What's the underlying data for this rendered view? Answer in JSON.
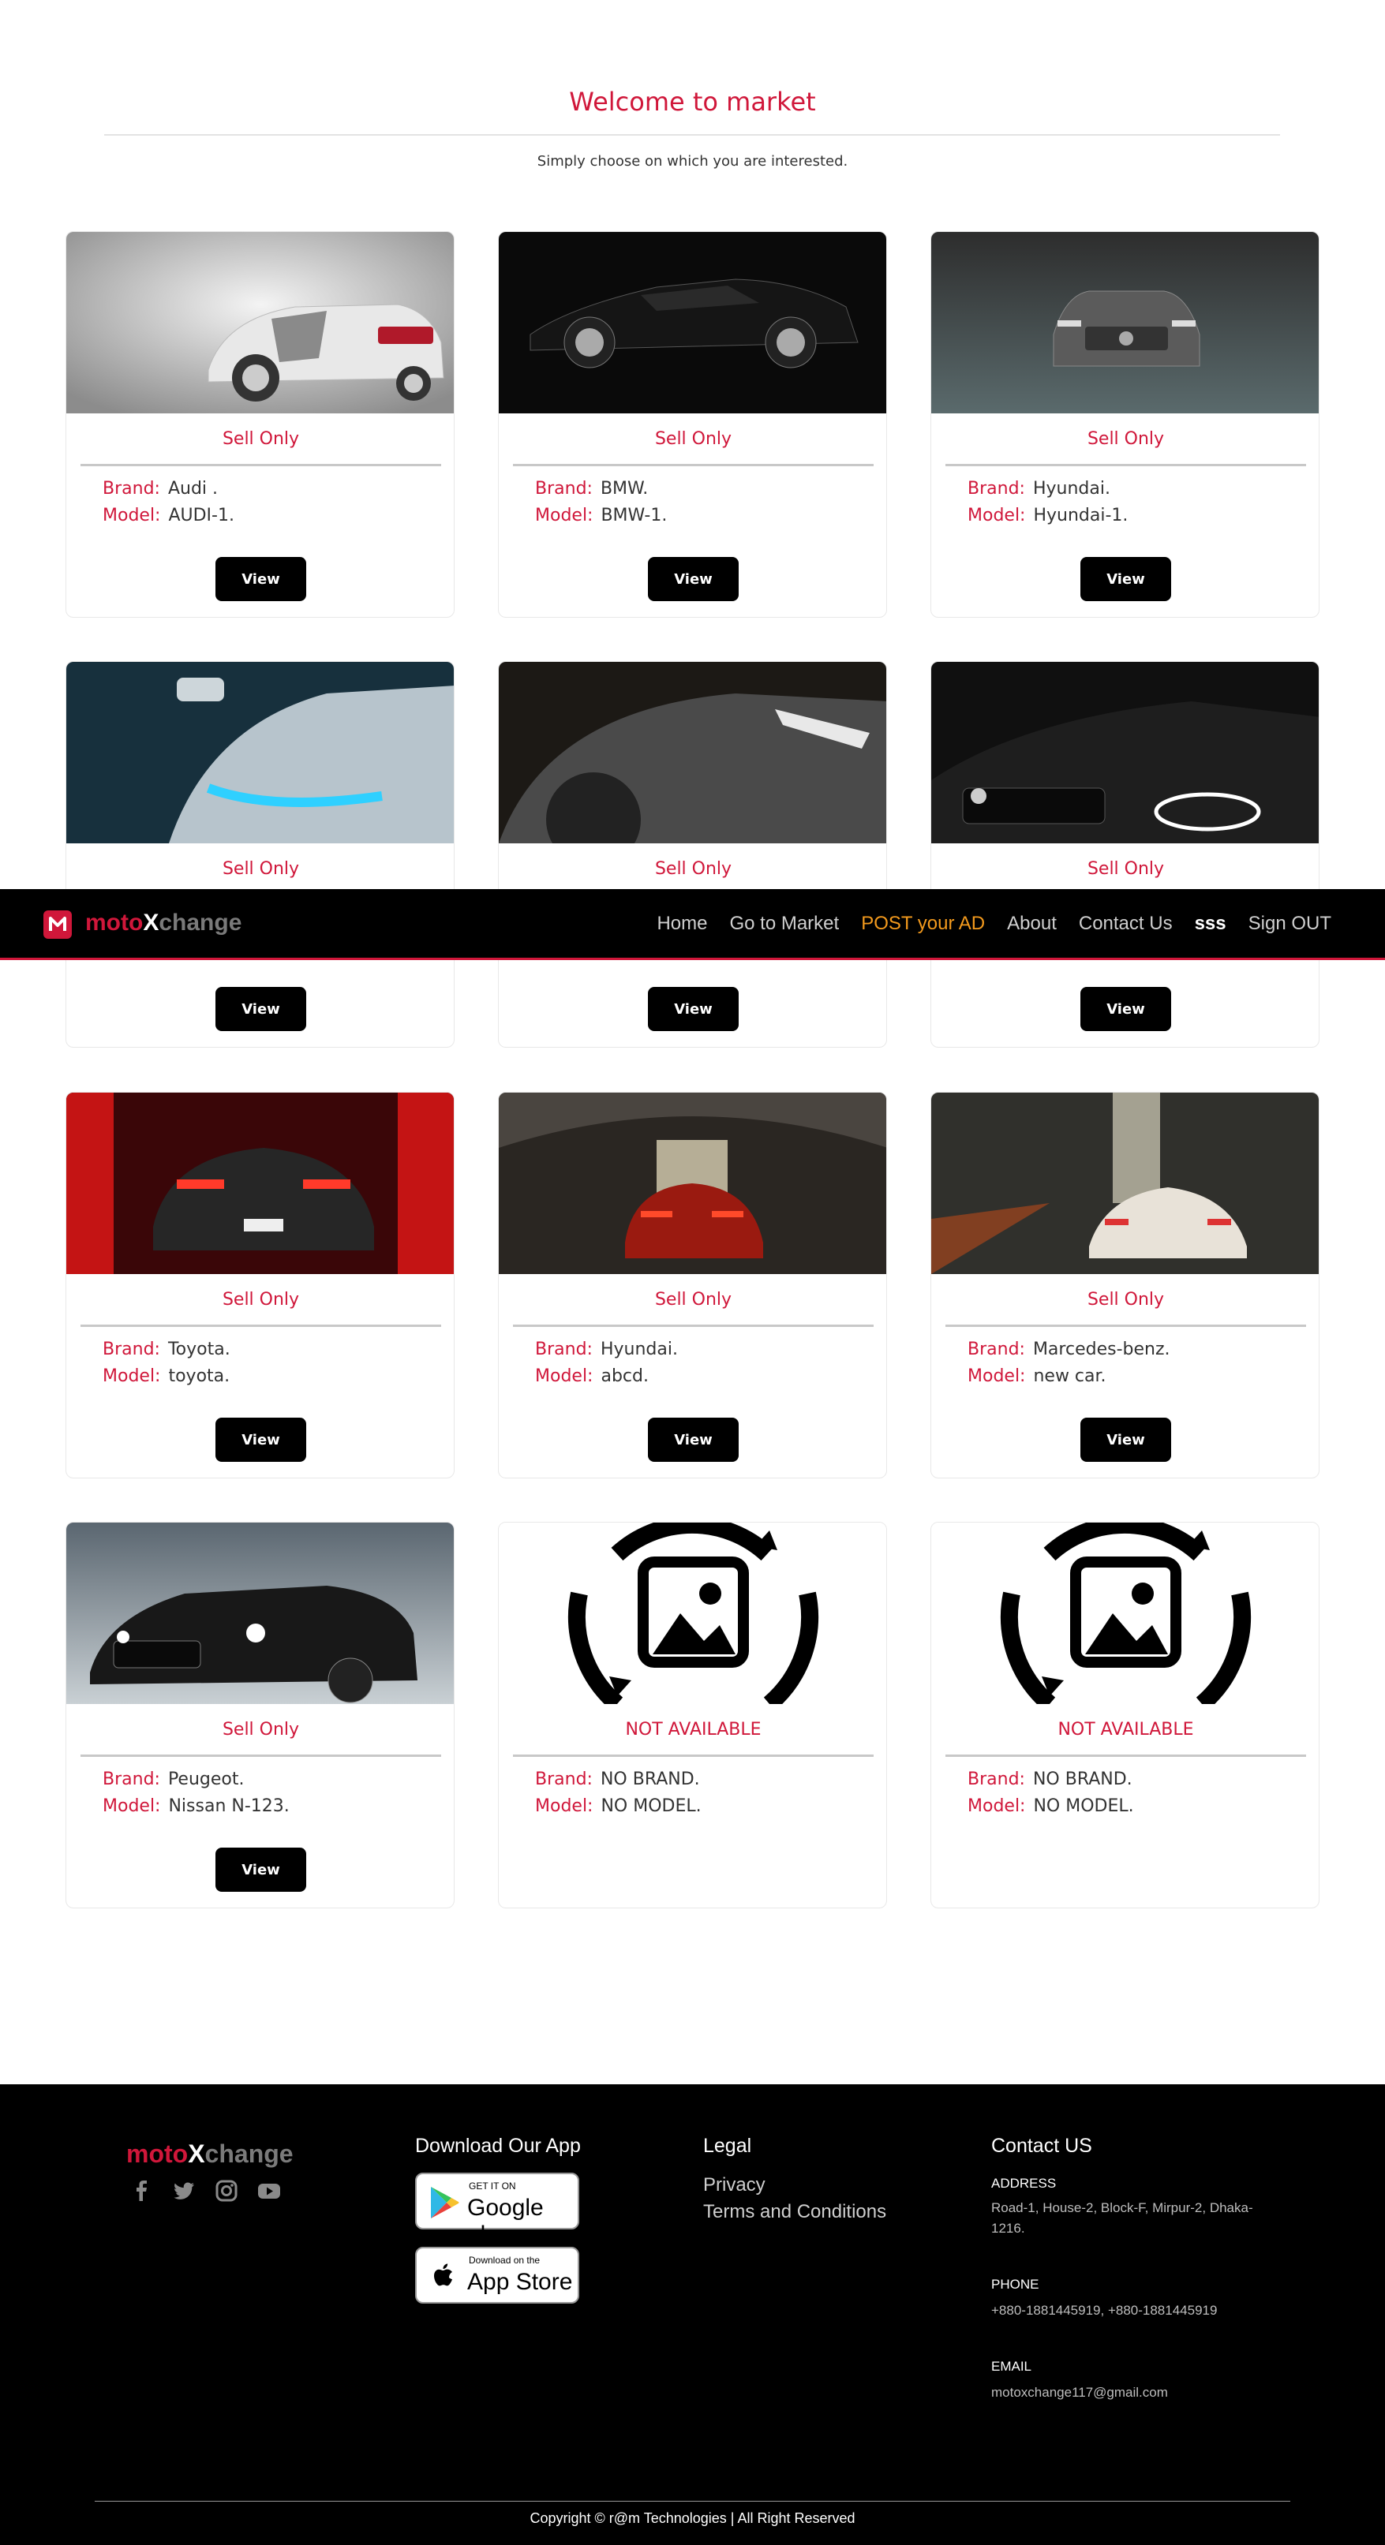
{
  "hero": {
    "title": "Welcome to market",
    "subtitle": "Simply choose on which you are interested."
  },
  "colors": {
    "accent": "#d0173a",
    "nav_active": "#f39a1d",
    "button": "#000000"
  },
  "spec_labels": {
    "brand": "Brand:",
    "model": "Model:"
  },
  "view_label": "View",
  "cards": [
    {
      "status": "Sell Only",
      "brand": "Audi .",
      "model": "AUDI-1.",
      "image": "white-audi-r8"
    },
    {
      "status": "Sell Only",
      "brand": "BMW.",
      "model": "BMW-1.",
      "image": "black-lamborghini-side"
    },
    {
      "status": "Sell Only",
      "brand": "Hyundai.",
      "model": "Hyundai-1.",
      "image": "volvo-suv-front"
    },
    {
      "status": "Sell Only",
      "brand": "",
      "model": "",
      "image": "audi-blue-headlight"
    },
    {
      "status": "Sell Only",
      "brand": "",
      "model": "",
      "image": "grey-lamborghini-headlight"
    },
    {
      "status": "Sell Only",
      "brand": "",
      "model": "",
      "image": "bmw-front-dark"
    },
    {
      "status": "Sell Only",
      "brand": "Toyota.",
      "model": "toyota.",
      "image": "red-ferrari-rear"
    },
    {
      "status": "Sell Only",
      "brand": "Hyundai.",
      "model": "abcd.",
      "image": "ferrari-in-hangar"
    },
    {
      "status": "Sell Only",
      "brand": "Marcedes-benz.",
      "model": "new car.",
      "image": "white-supercar-hangar"
    },
    {
      "status": "Sell Only",
      "brand": "Peugeot.",
      "model": "Nissan N-123.",
      "image": "maserati-black"
    },
    {
      "status": "NOT AVAILABLE",
      "brand": "NO BRAND.",
      "model": "NO MODEL.",
      "image": "image-placeholder-icon"
    },
    {
      "status": "NOT AVAILABLE",
      "brand": "NO BRAND.",
      "model": "NO MODEL.",
      "image": "image-placeholder-icon"
    }
  ],
  "nav": {
    "brand_part1": "moto",
    "brand_part2": "X",
    "brand_part3": "change",
    "links": [
      "Home",
      "Go to Market",
      "POST your AD",
      "About",
      "Contact Us",
      "sss",
      "Sign OUT"
    ]
  },
  "footer": {
    "brand_part1": "moto",
    "brand_part2": "X",
    "brand_part3": "change",
    "download_title": "Download Our App",
    "google_small": "GET IT ON",
    "google_big": "Google play",
    "apple_small": "Download on the",
    "apple_big": "App Store",
    "legal_title": "Legal",
    "legal_links": [
      "Privacy",
      "Terms and Conditions"
    ],
    "contact_title": "Contact US",
    "address_label": "ADDRESS",
    "address": "Road-1, House-2, Block-F, Mirpur-2, Dhaka-1216.",
    "phone_label": "PHONE",
    "phone": "+880-1881445919, +880-1881445919",
    "email_label": "EMAIL",
    "email": "motoxchange117@gmail.com",
    "copyright": "Copyright © r@m Technologies | All Right Reserved"
  }
}
